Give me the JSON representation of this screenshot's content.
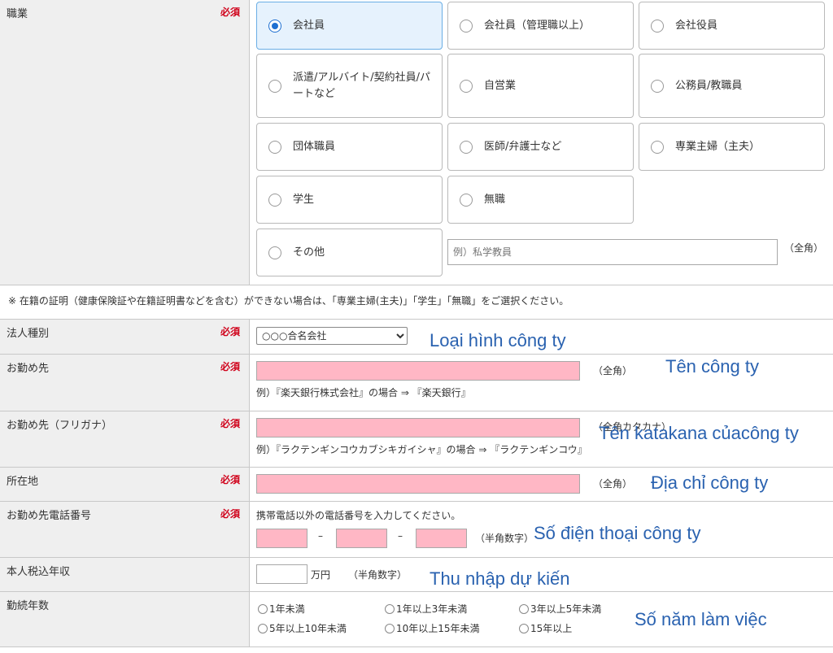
{
  "required_label": "必須",
  "occupation": {
    "label": "職業",
    "options": [
      {
        "label": "会社員",
        "selected": true
      },
      {
        "label": "会社員（管理職以上）",
        "selected": false
      },
      {
        "label": "会社役員",
        "selected": false
      },
      {
        "label": "派遣/アルバイト/契約社員/パートなど",
        "selected": false
      },
      {
        "label": "自営業",
        "selected": false
      },
      {
        "label": "公務員/教職員",
        "selected": false
      },
      {
        "label": "団体職員",
        "selected": false
      },
      {
        "label": "医師/弁護士など",
        "selected": false
      },
      {
        "label": "専業主婦（主夫）",
        "selected": false
      },
      {
        "label": "学生",
        "selected": false
      },
      {
        "label": "無職",
        "selected": false
      },
      {
        "label": "その他",
        "selected": false
      }
    ],
    "other_placeholder": "例）私学教員",
    "other_hint": "（全角）"
  },
  "notice": "※ 在籍の証明（健康保険証や在籍証明書などを含む）ができない場合は、「専業主婦(主夫)」「学生」「無職」をご選択ください。",
  "corp_type": {
    "label": "法人種別",
    "selected": "○○○合名会社",
    "annotation": "Loại hình công ty"
  },
  "employer": {
    "label": "お勤め先",
    "hint": "（全角）",
    "example": "例）『楽天銀行株式会社』の場合 ⇒ 『楽天銀行』",
    "annotation": "Tên công ty"
  },
  "employer_kana": {
    "label": "お勤め先（フリガナ）",
    "hint": "（全角カタカナ）",
    "example": "例）『ラクテンギンコウカブシキガイシャ』の場合 ⇒ 『ラクテンギンコウ』",
    "annotation": "Tên katakana củacông ty"
  },
  "address": {
    "label": "所在地",
    "hint": "（全角）",
    "annotation": "Địa chỉ công ty"
  },
  "phone": {
    "label": "お勤め先電話番号",
    "instruction": "携帯電話以外の電話番号を入力してください。",
    "separator": "–",
    "hint": "（半角数字）",
    "annotation": "Số điện thoại công ty"
  },
  "income": {
    "label": "本人税込年収",
    "unit": "万円",
    "hint": "（半角数字）",
    "annotation": "Thu nhập dự kiến"
  },
  "years": {
    "label": "勤続年数",
    "options": [
      "1年未満",
      "1年以上3年未満",
      "3年以上5年未満",
      "5年以上10年未満",
      "10年以上15年未満",
      "15年以上"
    ],
    "annotation": "Số năm làm việc"
  }
}
